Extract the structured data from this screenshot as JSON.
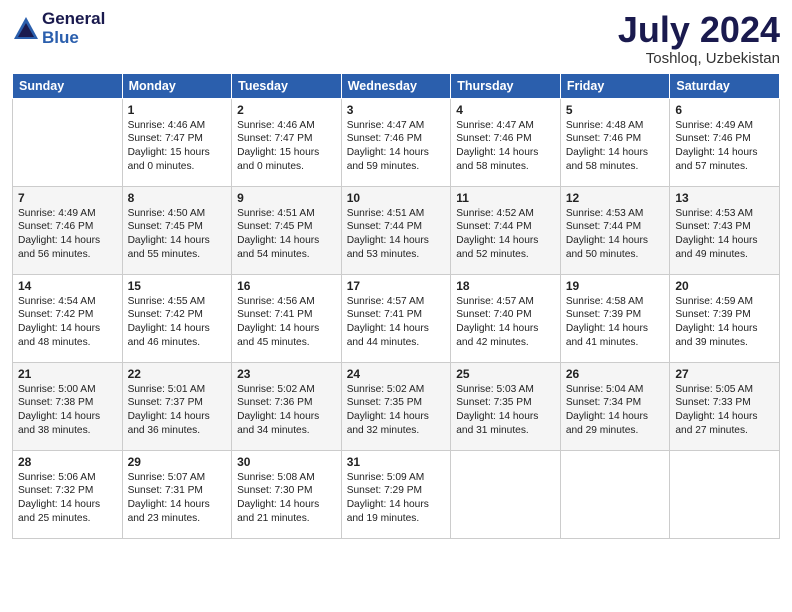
{
  "header": {
    "logo_general": "General",
    "logo_blue": "Blue",
    "title": "July 2024",
    "location": "Toshloq, Uzbekistan"
  },
  "days_of_week": [
    "Sunday",
    "Monday",
    "Tuesday",
    "Wednesday",
    "Thursday",
    "Friday",
    "Saturday"
  ],
  "weeks": [
    [
      {
        "day": "",
        "info": ""
      },
      {
        "day": "1",
        "info": "Sunrise: 4:46 AM\nSunset: 7:47 PM\nDaylight: 15 hours\nand 0 minutes."
      },
      {
        "day": "2",
        "info": "Sunrise: 4:46 AM\nSunset: 7:47 PM\nDaylight: 15 hours\nand 0 minutes."
      },
      {
        "day": "3",
        "info": "Sunrise: 4:47 AM\nSunset: 7:46 PM\nDaylight: 14 hours\nand 59 minutes."
      },
      {
        "day": "4",
        "info": "Sunrise: 4:47 AM\nSunset: 7:46 PM\nDaylight: 14 hours\nand 58 minutes."
      },
      {
        "day": "5",
        "info": "Sunrise: 4:48 AM\nSunset: 7:46 PM\nDaylight: 14 hours\nand 58 minutes."
      },
      {
        "day": "6",
        "info": "Sunrise: 4:49 AM\nSunset: 7:46 PM\nDaylight: 14 hours\nand 57 minutes."
      }
    ],
    [
      {
        "day": "7",
        "info": "Sunrise: 4:49 AM\nSunset: 7:46 PM\nDaylight: 14 hours\nand 56 minutes."
      },
      {
        "day": "8",
        "info": "Sunrise: 4:50 AM\nSunset: 7:45 PM\nDaylight: 14 hours\nand 55 minutes."
      },
      {
        "day": "9",
        "info": "Sunrise: 4:51 AM\nSunset: 7:45 PM\nDaylight: 14 hours\nand 54 minutes."
      },
      {
        "day": "10",
        "info": "Sunrise: 4:51 AM\nSunset: 7:44 PM\nDaylight: 14 hours\nand 53 minutes."
      },
      {
        "day": "11",
        "info": "Sunrise: 4:52 AM\nSunset: 7:44 PM\nDaylight: 14 hours\nand 52 minutes."
      },
      {
        "day": "12",
        "info": "Sunrise: 4:53 AM\nSunset: 7:44 PM\nDaylight: 14 hours\nand 50 minutes."
      },
      {
        "day": "13",
        "info": "Sunrise: 4:53 AM\nSunset: 7:43 PM\nDaylight: 14 hours\nand 49 minutes."
      }
    ],
    [
      {
        "day": "14",
        "info": "Sunrise: 4:54 AM\nSunset: 7:42 PM\nDaylight: 14 hours\nand 48 minutes."
      },
      {
        "day": "15",
        "info": "Sunrise: 4:55 AM\nSunset: 7:42 PM\nDaylight: 14 hours\nand 46 minutes."
      },
      {
        "day": "16",
        "info": "Sunrise: 4:56 AM\nSunset: 7:41 PM\nDaylight: 14 hours\nand 45 minutes."
      },
      {
        "day": "17",
        "info": "Sunrise: 4:57 AM\nSunset: 7:41 PM\nDaylight: 14 hours\nand 44 minutes."
      },
      {
        "day": "18",
        "info": "Sunrise: 4:57 AM\nSunset: 7:40 PM\nDaylight: 14 hours\nand 42 minutes."
      },
      {
        "day": "19",
        "info": "Sunrise: 4:58 AM\nSunset: 7:39 PM\nDaylight: 14 hours\nand 41 minutes."
      },
      {
        "day": "20",
        "info": "Sunrise: 4:59 AM\nSunset: 7:39 PM\nDaylight: 14 hours\nand 39 minutes."
      }
    ],
    [
      {
        "day": "21",
        "info": "Sunrise: 5:00 AM\nSunset: 7:38 PM\nDaylight: 14 hours\nand 38 minutes."
      },
      {
        "day": "22",
        "info": "Sunrise: 5:01 AM\nSunset: 7:37 PM\nDaylight: 14 hours\nand 36 minutes."
      },
      {
        "day": "23",
        "info": "Sunrise: 5:02 AM\nSunset: 7:36 PM\nDaylight: 14 hours\nand 34 minutes."
      },
      {
        "day": "24",
        "info": "Sunrise: 5:02 AM\nSunset: 7:35 PM\nDaylight: 14 hours\nand 32 minutes."
      },
      {
        "day": "25",
        "info": "Sunrise: 5:03 AM\nSunset: 7:35 PM\nDaylight: 14 hours\nand 31 minutes."
      },
      {
        "day": "26",
        "info": "Sunrise: 5:04 AM\nSunset: 7:34 PM\nDaylight: 14 hours\nand 29 minutes."
      },
      {
        "day": "27",
        "info": "Sunrise: 5:05 AM\nSunset: 7:33 PM\nDaylight: 14 hours\nand 27 minutes."
      }
    ],
    [
      {
        "day": "28",
        "info": "Sunrise: 5:06 AM\nSunset: 7:32 PM\nDaylight: 14 hours\nand 25 minutes."
      },
      {
        "day": "29",
        "info": "Sunrise: 5:07 AM\nSunset: 7:31 PM\nDaylight: 14 hours\nand 23 minutes."
      },
      {
        "day": "30",
        "info": "Sunrise: 5:08 AM\nSunset: 7:30 PM\nDaylight: 14 hours\nand 21 minutes."
      },
      {
        "day": "31",
        "info": "Sunrise: 5:09 AM\nSunset: 7:29 PM\nDaylight: 14 hours\nand 19 minutes."
      },
      {
        "day": "",
        "info": ""
      },
      {
        "day": "",
        "info": ""
      },
      {
        "day": "",
        "info": ""
      }
    ]
  ]
}
